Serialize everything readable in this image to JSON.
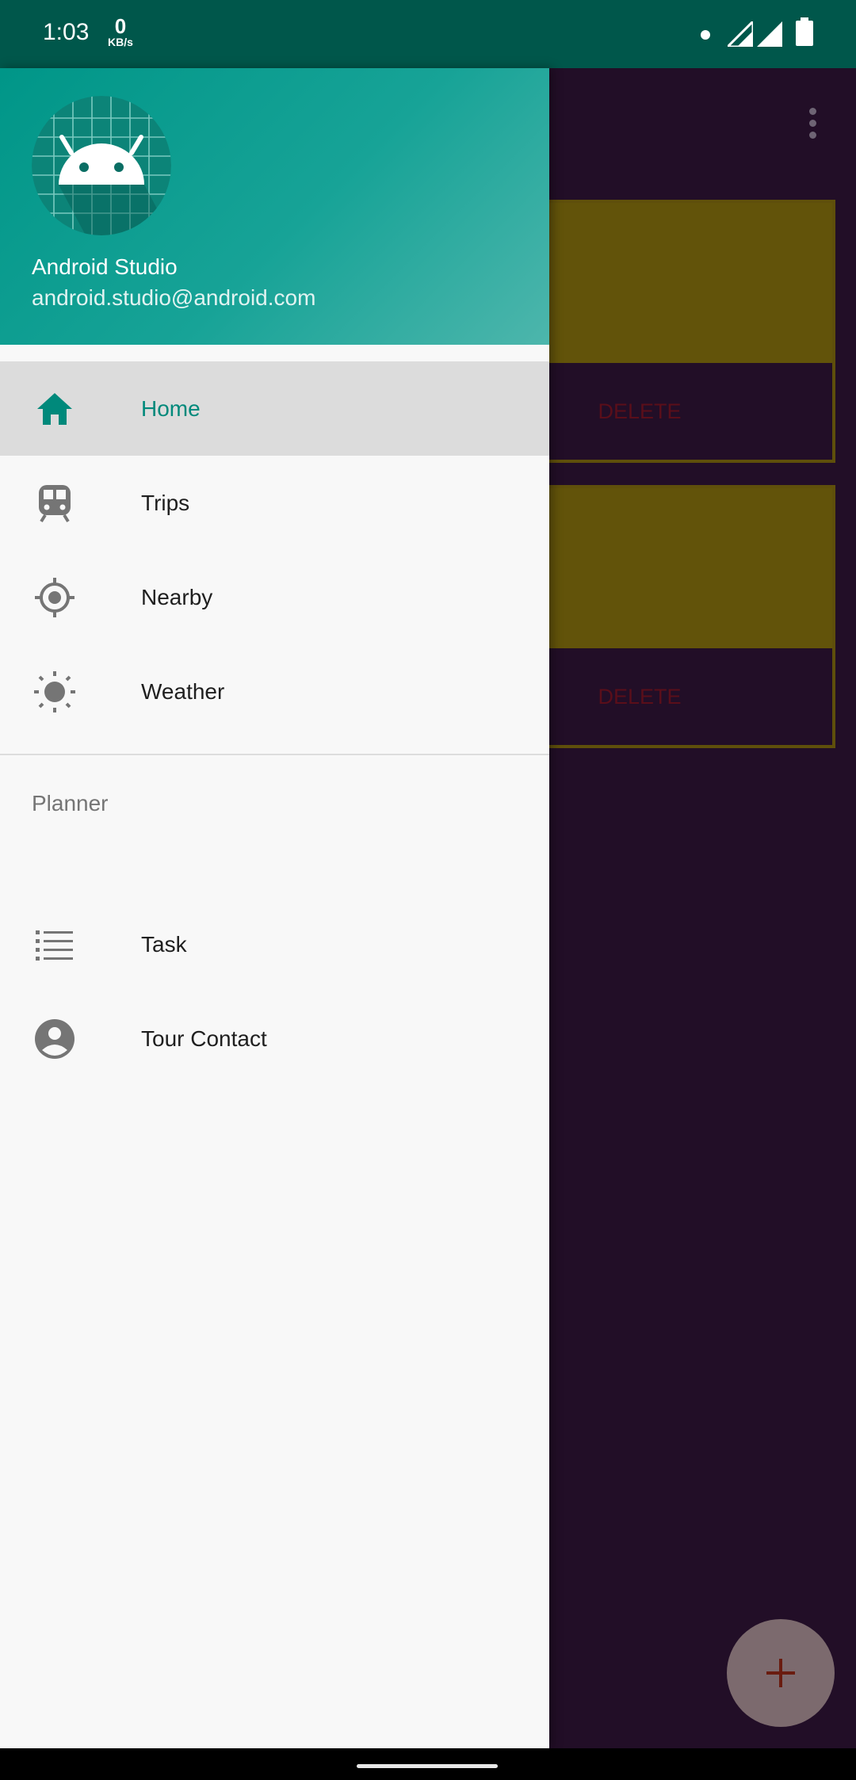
{
  "status_bar": {
    "time": "1:03",
    "speed_value": "0",
    "speed_unit": "KB/s",
    "icons": [
      "notification-dot-icon",
      "signal-icon",
      "signal-icon",
      "battery-icon"
    ]
  },
  "drawer": {
    "header": {
      "name": "Android Studio",
      "email": "android.studio@android.com",
      "avatar_icon": "android-robot-icon"
    },
    "primary_items": [
      {
        "label": "Home",
        "icon": "home-icon",
        "active": true
      },
      {
        "label": "Trips",
        "icon": "train-icon",
        "active": false
      },
      {
        "label": "Nearby",
        "icon": "location-target-icon",
        "active": false
      },
      {
        "label": "Weather",
        "icon": "sun-icon",
        "active": false
      }
    ],
    "section_title": "Planner",
    "section_items": [
      {
        "label": "Task",
        "icon": "list-icon"
      },
      {
        "label": "Tour Contact",
        "icon": "account-circle-icon"
      }
    ]
  },
  "background_app": {
    "cards": [
      {
        "button_label": "DELETE"
      },
      {
        "button_label": "DELETE"
      }
    ],
    "fab_icon": "plus-icon",
    "menu_icon": "overflow-menu-icon"
  },
  "colors": {
    "accent": "#00897b",
    "header_start": "#009688",
    "app_background": "#220e27",
    "card_fill": "#62530a"
  }
}
